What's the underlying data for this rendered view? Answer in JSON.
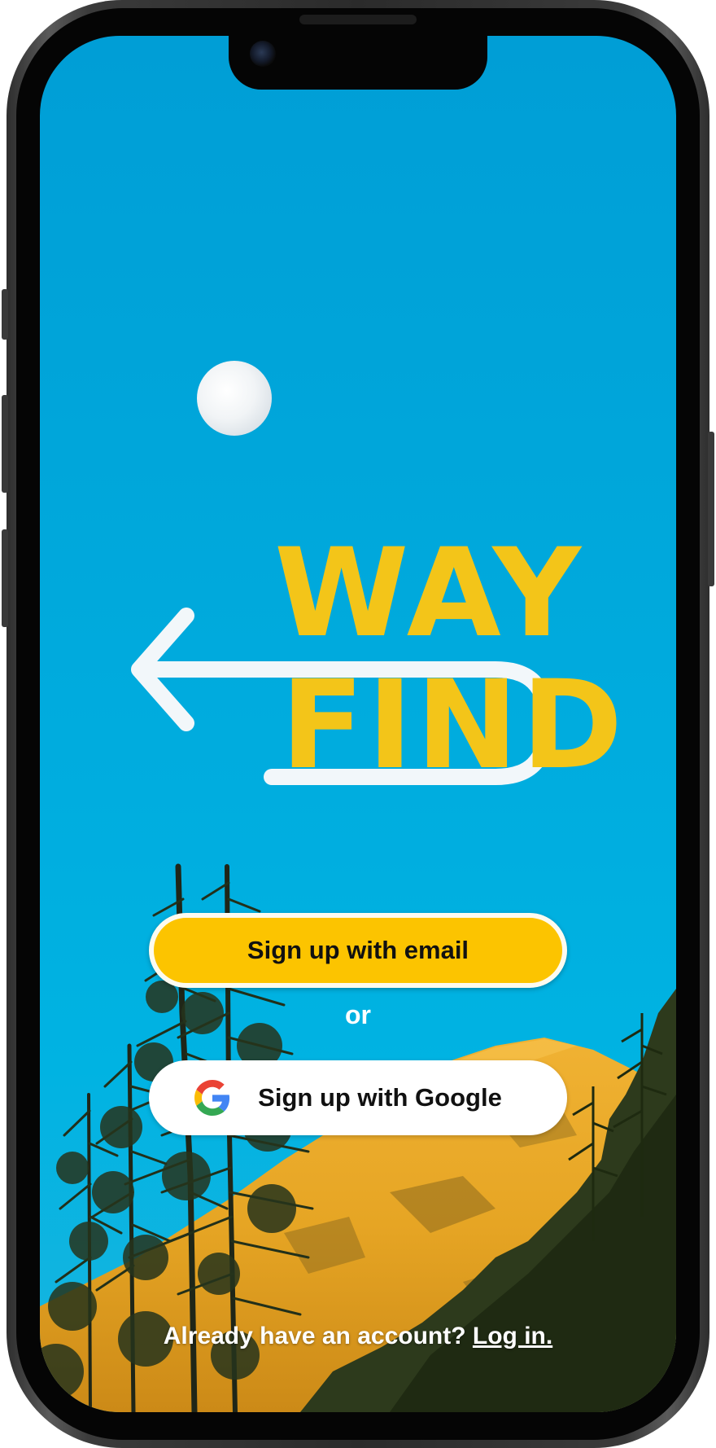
{
  "app": {
    "logo_line1": "WAY",
    "logo_line2": "FIND"
  },
  "actions": {
    "email_button_label": "Sign up with email",
    "separator": "or",
    "google_button_label": "Sign up with Google"
  },
  "footer": {
    "prompt": "Already have an account?",
    "login_link": "Log in."
  },
  "icons": {
    "moon": "moon-icon",
    "arrow": "arrow-left-icon",
    "google": "google-icon"
  },
  "colors": {
    "sky": "#00a6da",
    "accent_yellow": "#fcc400",
    "logo_yellow": "#f3c519",
    "white": "#ffffff"
  }
}
